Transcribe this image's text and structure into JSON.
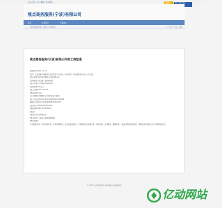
{
  "topbar": {
    "links": "设为首页 | 加入收藏 | 联系我们"
  },
  "member_badge": {
    "label": "Free Member"
  },
  "header": {
    "site_title": "焦点商务服务(宁波)有限公司"
  },
  "nav": {
    "items": [
      "首页",
      "公司简介",
      "产品中心"
    ]
  },
  "breadcrumb": {
    "path": "您当前的位置：首页 » 公司简介",
    "pager": "上一页 下一页 | 首页"
  },
  "info": {
    "title": "焦点商务服务(宁波)有限公司的工商信息",
    "lines": [
      "更新时间:2021-11-14",
      "声明：信息来源于国家企业信用信息公示系统，仅供参考，如有变更请以官方公示为准。",
      "[企业名称]:焦点商务服务(宁波)有限公司",
      "[注册地址]:浙江省宁波市鄞州区",
      "[法定代表人]:Helge Haraland",
      "[注册资本]:50万元",
      "[成立日期]:2012-02-03",
      "[经营状态]:开业",
      "[公司类型]:有限责任公司(外国法人独资)",
      "[统一社会信用代码]:91330200587445022B",
      "[纳税人识别号]:91330200587445022B",
      "[注册号]:330200400070382",
      "[组织机构代码]:58744502-2",
      "[电话]:",
      "[所属行业]:商务服务业",
      "[登记机关]:宁波市市场监督管理局",
      "[经营范围]:",
      "企业管理咨询；商务信息咨询；市场营销策划；会议及展览服务；计算机软件的技术开发、技术咨询、技术服务；翻译服务。（依法须经批准的项目，经相关部门批准后方可开展经营活动）"
    ]
  },
  "footer": {
    "copyright": "© 2023 焦点商务服务(宁波)有限公司 版权所有"
  },
  "watermark": {
    "text": "亿动网站"
  }
}
